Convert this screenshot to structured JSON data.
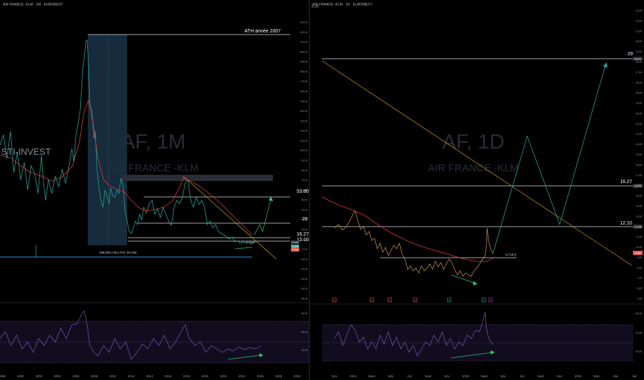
{
  "left": {
    "header": "AIR FRANCE -KLM · 1M · EURONEXT",
    "watermark_symbol": "AF, 1M",
    "watermark_name": "AIR FRANCE -KLM",
    "brand": "STI-INVEST",
    "currency_label": "EUR",
    "ath_label": "ATH année 2007",
    "levels": [
      {
        "text": "53.80",
        "value": 53.8
      },
      {
        "text": "29",
        "value": 29
      },
      {
        "text": "16.27",
        "value": 16.27
      },
      {
        "text": "12.10",
        "value": 12.1
      }
    ],
    "measure_label": "-188,050 (-95,17%) -94 425",
    "small_label": "8.719.5",
    "price_tags": [
      "10,000",
      "9,466",
      "7,719"
    ],
    "x_ticks": [
      "1998",
      "2000",
      "2002",
      "2004",
      "2006",
      "2008",
      "2010",
      "2012",
      "2014",
      "2016",
      "2018",
      "2020",
      "2022",
      "2024",
      "2026",
      "2028",
      "2030"
    ],
    "y_ticks": [
      "230,00",
      "220,00",
      "210,00",
      "200,00",
      "190,00",
      "180,00",
      "170,00",
      "160,00",
      "150,00",
      "140,00",
      "130,00",
      "120,00",
      "110,00",
      "100,00",
      "90,00",
      "80,00",
      "70,00",
      "60,00",
      "50,00",
      "40,00",
      "30,00",
      "20,00",
      "10,00",
      "0,00",
      "-10,00",
      "-20,00",
      "-30,00",
      "-40,00",
      "-50,00"
    ],
    "rsi_ticks": [
      "80,00",
      "60,00",
      "40,00"
    ]
  },
  "right": {
    "header": "AIR FRANCE -KLM · 1D · EURONEXT",
    "watermark_symbol": "AF, 1D",
    "watermark_name": "AIR FRANCE -KLM",
    "levels": [
      {
        "text": "29",
        "value": 29
      },
      {
        "text": "16.27",
        "value": 16.27
      },
      {
        "text": "12.10",
        "value": 12.1
      }
    ],
    "small_label": "8.719.5",
    "price_tags": [
      "29,000",
      "16,270",
      "12,100",
      "9,466"
    ],
    "event_markers": [
      "D",
      "D",
      "D",
      "D",
      "E",
      "E",
      "D"
    ],
    "x_ticks": [
      "Nov",
      "2024",
      "Mars",
      "Mai",
      "Juil",
      "Sept",
      "Nov",
      "2025",
      "Mars",
      "Mai",
      "Juil",
      "Sept",
      "Nov",
      "2026",
      "Mars",
      "Mai",
      "Juil"
    ],
    "y_ticks": [
      "33,00",
      "32,00",
      "31,00",
      "30,00",
      "29,00",
      "28,00",
      "27,00",
      "26,00",
      "25,00",
      "24,00",
      "23,00",
      "22,00",
      "21,00",
      "20,00",
      "19,00",
      "18,00",
      "17,00",
      "16,00",
      "15,00",
      "14,00",
      "13,00",
      "12,00",
      "11,00",
      "10,00",
      "9,00",
      "8,00",
      "7,00",
      "6,00",
      "5,00"
    ],
    "rsi_ticks": [
      "80,00",
      "60,00",
      "40,00"
    ]
  },
  "colors": {
    "background": "#000000",
    "price_line": "#26a69a",
    "ma_line": "#e53935",
    "projection": "#2ecc71",
    "trendline": "#c9a227",
    "rsi": "#7e57c2",
    "highlight_box": "#1e3a55",
    "price_tag": "#26a69a",
    "price_tag_red": "#ef5350"
  },
  "chart_data": [
    {
      "type": "line",
      "title": "AIR FRANCE -KLM · 1M · EURONEXT",
      "x": [
        1998,
        1999,
        2000,
        2001,
        2002,
        2003,
        2004,
        2005,
        2006,
        2007,
        2008,
        2009,
        2010,
        2011,
        2012,
        2013,
        2014,
        2015,
        2016,
        2017,
        2018,
        2019,
        2020,
        2021,
        2022,
        2023,
        2024,
        2025
      ],
      "series": [
        {
          "values": [
            40,
            55,
            60,
            45,
            60,
            45,
            70,
            80,
            110,
            198,
            110,
            60,
            45,
            55,
            20,
            25,
            40,
            30,
            45,
            20,
            60,
            40,
            15,
            12,
            10,
            9,
            8,
            9.5
          ]
        }
      ],
      "levels": [
        53.8,
        29,
        16.27,
        12.1
      ],
      "ylim": [
        -50,
        230
      ]
    },
    {
      "type": "line",
      "title": "AIR FRANCE -KLM · 1D · EURONEXT",
      "x": [
        "Nov",
        "2024",
        "Mars",
        "Mai",
        "Juil",
        "Sept",
        "Nov",
        "2025",
        "Mars"
      ],
      "series": [
        {
          "values": [
            11.5,
            12.5,
            13.5,
            11,
            10.2,
            8.5,
            8.0,
            8.8,
            12.5
          ]
        }
      ],
      "projection": [
        9.5,
        20,
        12.1,
        28
      ],
      "levels": [
        29,
        16.27,
        12.1,
        8.7195
      ],
      "ylim": [
        5,
        33
      ]
    }
  ]
}
